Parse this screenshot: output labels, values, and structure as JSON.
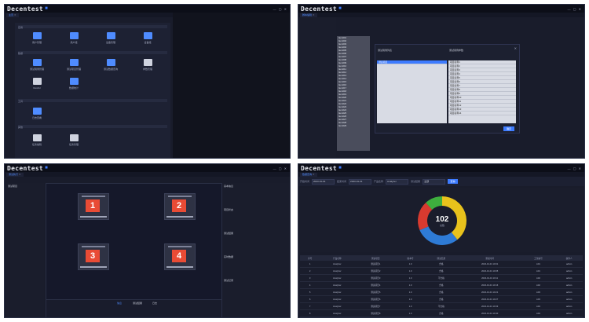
{
  "app": {
    "logo": "Decentest",
    "title": "…",
    "user": "admin ▾ 帮助 ▾"
  },
  "panel1": {
    "tab": "主页",
    "sections": [
      "应用",
      "数据",
      "工具",
      "其他"
    ],
    "tiles": [
      {
        "label": "用户管理",
        "color": "#4f8cff"
      },
      {
        "label": "用户组",
        "color": "#4f8cff"
      },
      {
        "label": "设备管理",
        "color": "#4f8cff"
      },
      {
        "label": "设备组",
        "color": "#4f8cff"
      },
      {
        "label": "测试用例管理",
        "color": "#4f8cff"
      },
      {
        "label": "测试项目管理",
        "color": "#4f8cff"
      },
      {
        "label": "测试数据查询",
        "color": "#4f8cff"
      },
      {
        "label": "参数管理",
        "color": "#cfd3df"
      },
      {
        "label": "Restful",
        "color": "#cfd3df"
      },
      {
        "label": "数据统计",
        "color": "#4f8cff"
      },
      {
        "label": "日志查看",
        "color": "#4f8cff"
      },
      {
        "label": "任务编辑",
        "color": "#cfd3df"
      },
      {
        "label": "任务管理",
        "color": "#cfd3df"
      }
    ]
  },
  "panel2": {
    "tab": "脚本编辑",
    "dialog_left_title": "测试用例列表",
    "dialog_right_title": "测试用例参数",
    "left_items": [
      "测试项目"
    ],
    "right_items": [
      "项目名称1",
      "项目名称2",
      "项目名称3",
      "项目名称4",
      "项目名称5",
      "项目名称6",
      "项目名称7",
      "项目名称8",
      "项目名称9",
      "项目名称10",
      "项目名称11",
      "项目名称12",
      "项目名称13",
      "项目名称14"
    ],
    "list_items": [
      "Item001",
      "Item002",
      "Item003",
      "Item004",
      "Item005",
      "Item006",
      "Item007",
      "Item008",
      "Item009",
      "Item010",
      "Item011",
      "Item012",
      "Item013",
      "Item014",
      "Item015",
      "Item016",
      "Item017",
      "Item018",
      "Item019",
      "Item020",
      "Item021",
      "Item022",
      "Item023",
      "Item024",
      "Item025",
      "Item026",
      "Item027",
      "Item028",
      "Item029"
    ],
    "ok": "确定"
  },
  "panel3": {
    "tab": "测试执行",
    "cells": [
      "1",
      "2",
      "3",
      "4"
    ],
    "side_title": "测试项目",
    "right_labels": [
      "基本信息",
      "项目状态",
      "测试结果",
      "实时数据",
      "测试记录"
    ],
    "bottom_tabs": [
      "信息",
      "测试结果",
      "日志"
    ]
  },
  "panel4": {
    "tab": "数据查询",
    "filters": [
      "开始时间",
      "结束时间",
      "产品名称",
      "测试结果"
    ],
    "filter_values": [
      "2023-01-01",
      "2023-01-31",
      "Analyzer",
      "全部"
    ],
    "query": "查询",
    "total_value": "102",
    "total_label": "总数",
    "table_headers": [
      "序号",
      "产品名称",
      "测试项目",
      "版本号",
      "测试结果",
      "测试时间",
      "工位编号",
      "操作人"
    ],
    "rows": [
      [
        "1",
        "Analyzer",
        "测试项目1",
        "1.0",
        "合格",
        "2023-01-01 10:01",
        "A01",
        "admin"
      ],
      [
        "2",
        "Analyzer",
        "测试项目2",
        "1.0",
        "合格",
        "2023-01-01 10:05",
        "A01",
        "admin"
      ],
      [
        "3",
        "Analyzer",
        "测试项目3",
        "1.0",
        "不合格",
        "2023-01-01 10:11",
        "A02",
        "admin"
      ],
      [
        "4",
        "Analyzer",
        "测试项目4",
        "1.0",
        "合格",
        "2023-01-01 10:16",
        "A02",
        "admin"
      ],
      [
        "5",
        "Analyzer",
        "测试项目5",
        "1.0",
        "合格",
        "2023-01-01 10:21",
        "A03",
        "admin"
      ],
      [
        "6",
        "Analyzer",
        "测试项目6",
        "1.0",
        "合格",
        "2023-01-01 10:27",
        "A03",
        "admin"
      ],
      [
        "7",
        "Analyzer",
        "测试项目7",
        "1.0",
        "不合格",
        "2023-01-01 10:33",
        "A04",
        "admin"
      ],
      [
        "8",
        "Analyzer",
        "测试项目8",
        "1.0",
        "合格",
        "2023-01-01 10:40",
        "A04",
        "admin"
      ],
      [
        "9",
        "Analyzer",
        "测试项目9",
        "1.0",
        "合格",
        "2023-01-01 10:44",
        "A05",
        "admin"
      ],
      [
        "10",
        "Analyzer",
        "测试项目10",
        "1.0",
        "合格",
        "2023-01-01 10:50",
        "A05",
        "admin"
      ]
    ]
  },
  "chart_data": {
    "type": "pie",
    "categories": [
      "合格",
      "不合格",
      "待测",
      "其他"
    ],
    "values": [
      40,
      30,
      20,
      12
    ],
    "colors": [
      "#e8c21c",
      "#2e7bd6",
      "#d83a2f",
      "#3eae3e"
    ],
    "title": ""
  }
}
